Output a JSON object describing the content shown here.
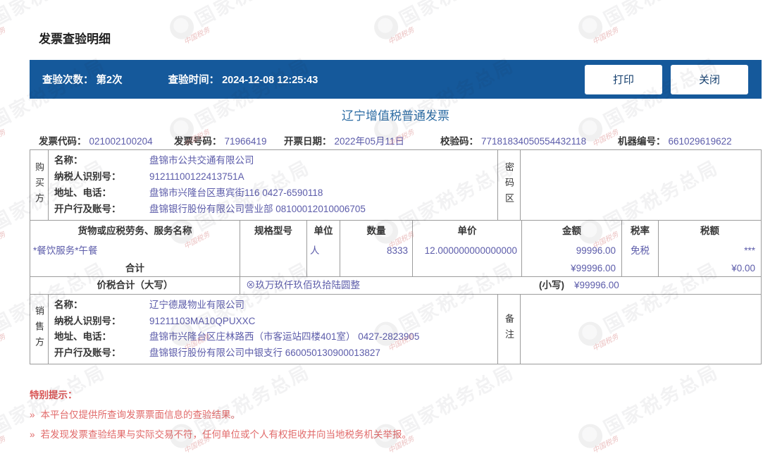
{
  "page": {
    "heading": "发票查验明细",
    "watermark": {
      "text": "国家税务总局",
      "sub_text": "中国税务"
    }
  },
  "toolbar": {
    "check_count_label": "查验次数：",
    "check_count_value": "第2次",
    "check_time_label": "查验时间：",
    "check_time_value": "2024-12-08 12:25:43",
    "print_label": "打印",
    "close_label": "关闭"
  },
  "invoice": {
    "title": "辽宁增值税普通发票",
    "meta": [
      {
        "label": "发票代码：",
        "value": "021002100204"
      },
      {
        "label": "发票号码：",
        "value": "71966419"
      },
      {
        "label": "开票日期：",
        "value": "2022年05月11日"
      },
      {
        "label": "校验码：",
        "value": "77181834050554432118"
      },
      {
        "label": "机器编号：",
        "value": "661029619622"
      }
    ],
    "buyer": {
      "side_label": "购买方",
      "password_label": "密码区",
      "rows": [
        {
          "label": "名称：",
          "value": "盘锦市公共交通有限公司"
        },
        {
          "label": "纳税人识别号：",
          "value": "91211100122413751A"
        },
        {
          "label": "地址、电话：",
          "value": "盘锦市兴隆台区惠宾街116 0427-6590118"
        },
        {
          "label": "开户行及账号：",
          "value": "盘锦银行股份有限公司营业部 08100012010006705"
        }
      ]
    },
    "items_table": {
      "headers": [
        "货物或应税劳务、服务名称",
        "规格型号",
        "单位",
        "数量",
        "单价",
        "金额",
        "税率",
        "税额"
      ],
      "rows": [
        {
          "name": "*餐饮服务*午餐",
          "spec": "",
          "unit": "人",
          "qty": "8333",
          "price": "12.000000000000000",
          "amount": "99996.00",
          "tax_rate": "免税",
          "tax": "***"
        }
      ],
      "total_label": "合计",
      "total_amount": "¥99996.00",
      "total_tax": "¥0.00"
    },
    "sum": {
      "label": "价税合计（大写）",
      "words": "⊗玖万玖仟玖佰玖拾陆圆整",
      "small_label": "(小写)",
      "small_value": "¥99996.00"
    },
    "seller": {
      "side_label": "销售方",
      "remark_label": "备注",
      "rows": [
        {
          "label": "名称：",
          "value": "辽宁德晟物业有限公司"
        },
        {
          "label": "纳税人识别号：",
          "value": "91211103MA10QPUXXC"
        },
        {
          "label": "地址、电话：",
          "value": "盘锦市兴隆台区庄林路西（市客运站四楼401室） 0427-2823905"
        },
        {
          "label": "开户行及账号：",
          "value": "盘锦银行股份有限公司中银支行 660050130900013827"
        }
      ]
    }
  },
  "notice": {
    "title": "特别提示：",
    "bullet": "»",
    "items": [
      "本平台仅提供所查询发票票面信息的查验结果。",
      "若发现发票查验结果与实际交易不符，任何单位或个人有权拒收并向当地税务机关举报。"
    ]
  },
  "colors": {
    "bar": "#15599b",
    "accent": "#2e6da4",
    "value": "#5c5caa",
    "label": "#363636",
    "border": "#9c9c9c",
    "notice-title": "#d95555",
    "notice-text": "#e16a6a",
    "button-text": "#16406f"
  }
}
